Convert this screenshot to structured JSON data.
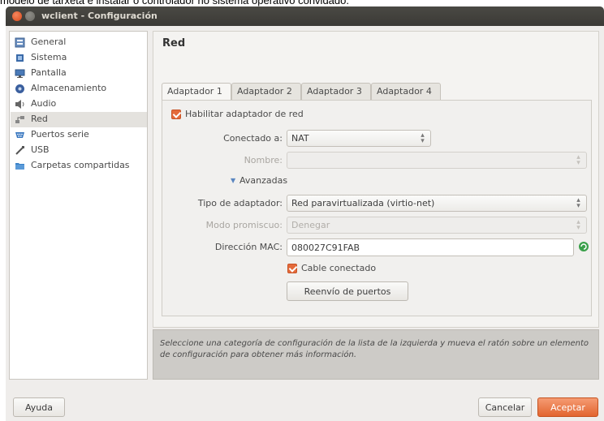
{
  "caption": "modelo de tarxeta e instalar o controlador no sistema operativo convidado.",
  "window": {
    "title": "wclient - Configuración"
  },
  "sidebar": {
    "items": [
      {
        "label": "General",
        "icon": "general-icon",
        "color": "#5a7fb0"
      },
      {
        "label": "Sistema",
        "icon": "chip-icon",
        "color": "#3a6aa8"
      },
      {
        "label": "Pantalla",
        "icon": "monitor-icon",
        "color": "#4a7ab8"
      },
      {
        "label": "Almacenamiento",
        "icon": "disk-icon",
        "color": "#3a5f9e"
      },
      {
        "label": "Audio",
        "icon": "speaker-icon",
        "color": "#666666"
      },
      {
        "label": "Red",
        "icon": "network-icon",
        "color": "#888888"
      },
      {
        "label": "Puertos serie",
        "icon": "serial-port-icon",
        "color": "#3a78c0"
      },
      {
        "label": "USB",
        "icon": "usb-icon",
        "color": "#555555"
      },
      {
        "label": "Carpetas compartidas",
        "icon": "folder-icon",
        "color": "#3a82c8"
      }
    ],
    "selected": "Red"
  },
  "panel": {
    "title": "Red",
    "tabs": [
      "Adaptador 1",
      "Adaptador 2",
      "Adaptador 3",
      "Adaptador 4"
    ],
    "active_tab": "Adaptador 1",
    "enable_adapter_label": "Habilitar adaptador de red",
    "attached_label": "Conectado a:",
    "attached_value": "NAT",
    "name_label": "Nombre:",
    "name_value": "",
    "advanced_label": "Avanzadas",
    "adapter_type_label": "Tipo de adaptador:",
    "adapter_type_value": "Red paravirtualizada (virtio-net)",
    "promisc_label": "Modo promiscuo:",
    "promisc_value": "Denegar",
    "mac_label": "Dirección MAC:",
    "mac_value": "080027C91FAB",
    "cable_label": "Cable conectado",
    "port_forward_label": "Reenvío de puertos"
  },
  "help": {
    "text": "Seleccione una categoría de configuración de la lista de la izquierda y mueva el ratón sobre un elemento de configuración para obtener más información."
  },
  "buttons": {
    "help": "Ayuda",
    "cancel": "Cancelar",
    "accept": "Aceptar"
  },
  "colors": {
    "accent": "#e2652f",
    "titlebar": "#3b3a36",
    "checkbox": "#e46a3a",
    "refresh": "#3aa04a"
  }
}
